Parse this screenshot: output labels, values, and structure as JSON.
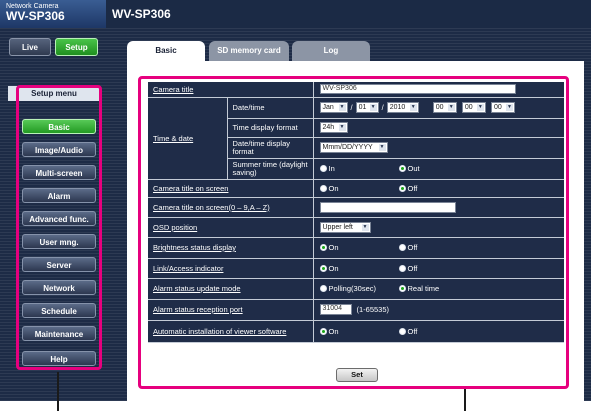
{
  "header": {
    "brand_line1": "Network Camera",
    "brand_line2": "WV-SP306",
    "model": "WV-SP306"
  },
  "mode": {
    "live_label": "Live",
    "setup_label": "Setup"
  },
  "sidebar": {
    "title": "Setup menu",
    "items": [
      {
        "label": "Basic",
        "active": true
      },
      {
        "label": "Image/Audio",
        "active": false
      },
      {
        "label": "Multi-screen",
        "active": false
      },
      {
        "label": "Alarm",
        "active": false
      },
      {
        "label": "Advanced func.",
        "active": false
      },
      {
        "label": "User mng.",
        "active": false
      },
      {
        "label": "Server",
        "active": false
      },
      {
        "label": "Network",
        "active": false
      },
      {
        "label": "Schedule",
        "active": false
      },
      {
        "label": "Maintenance",
        "active": false
      },
      {
        "label": "Help",
        "active": false
      }
    ]
  },
  "tabs": [
    {
      "label": "Basic",
      "active": true
    },
    {
      "label": "SD memory card",
      "active": false
    },
    {
      "label": "Log",
      "active": false
    }
  ],
  "form": {
    "camera_title": {
      "label": "Camera title",
      "value": "WV-SP306"
    },
    "time_date": {
      "label": "Time & date",
      "datetime": {
        "label": "Date/time",
        "month": "Jan",
        "day": "01",
        "year": "2010",
        "hour": "00",
        "minute": "00",
        "second": "00",
        "sep": "/"
      },
      "time_format": {
        "label": "Time display format",
        "value": "24h"
      },
      "date_format": {
        "label": "Date/time display format",
        "value": "Mmm/DD/YYYY"
      },
      "summer_time": {
        "label": "Summer time (daylight saving)",
        "opt1": "In",
        "opt2": "Out",
        "selected": "Out"
      }
    },
    "title_on_screen": {
      "label": "Camera title on screen",
      "opt1": "On",
      "opt2": "Off",
      "selected": "Off"
    },
    "title_text": {
      "label": "Camera title on screen(0 – 9,A – Z)",
      "value": ""
    },
    "osd_position": {
      "label": "OSD position",
      "value": "Upper left"
    },
    "brightness": {
      "label": "Brightness status display",
      "opt1": "On",
      "opt2": "Off",
      "selected": "On"
    },
    "link_indicator": {
      "label": "Link/Access indicator",
      "opt1": "On",
      "opt2": "Off",
      "selected": "On"
    },
    "alarm_mode": {
      "label": "Alarm status update mode",
      "opt1": "Polling(30sec)",
      "opt2": "Real time",
      "selected": "Real time"
    },
    "alarm_port": {
      "label": "Alarm status reception port",
      "value": "31004",
      "hint": "(1-65535)"
    },
    "auto_install": {
      "label": "Automatic installation of viewer software",
      "opt1": "On",
      "opt2": "Off",
      "selected": "On"
    },
    "set_label": "Set"
  },
  "colors": {
    "highlight": "#e6007e",
    "background": "#1d2b46",
    "active_green": "#2fae2f"
  }
}
